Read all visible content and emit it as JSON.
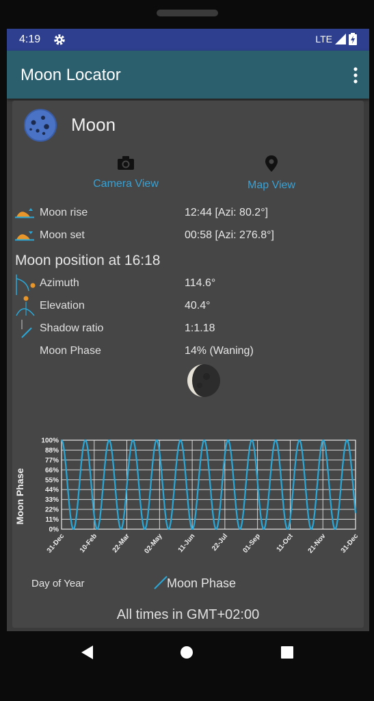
{
  "status_bar": {
    "time": "4:19",
    "network": "LTE"
  },
  "app_bar": {
    "title": "Moon Locator"
  },
  "header": {
    "title": "Moon"
  },
  "views": {
    "camera_label": "Camera View",
    "map_label": "Map View"
  },
  "rise_set": [
    {
      "label": "Moon rise",
      "value": "12:44 [Azi: 80.2°]"
    },
    {
      "label": "Moon set",
      "value": "00:58 [Azi: 276.8°]"
    }
  ],
  "position": {
    "title": "Moon position at 16:18",
    "rows": [
      {
        "label": "Azimuth",
        "value": "114.6°"
      },
      {
        "label": "Elevation",
        "value": "40.4°"
      },
      {
        "label": "Shadow ratio",
        "value": "1:1.18"
      },
      {
        "label": "Moon Phase",
        "value": "14% (Waning)"
      }
    ]
  },
  "colors": {
    "accent": "#37a2d6",
    "app_bar": "#2b5f6d",
    "status_bar": "#2d3f8e",
    "series": "#2aa8d8"
  },
  "chart_data": {
    "type": "line",
    "ylabel": "Moon Phase",
    "xlabel": "Day of Year",
    "y_ticks": [
      "100%",
      "88%",
      "77%",
      "66%",
      "55%",
      "44%",
      "33%",
      "22%",
      "11%",
      "0%"
    ],
    "x_ticks": [
      "31-Dec",
      "10-Feb",
      "22-Mar",
      "02-May",
      "11-Jun",
      "22-Jul",
      "01-Sep",
      "11-Oct",
      "21-Nov",
      "31-Dec"
    ],
    "ylim": [
      0,
      100
    ],
    "xlim": [
      0,
      365
    ],
    "grid": true,
    "legend_position": "bottom",
    "series": [
      {
        "name": "Moon Phase",
        "function": "cosine",
        "period_days": 29.53,
        "peaks_days": [
          0,
          29.5,
          59.1,
          88.6,
          118.1,
          147.7,
          177.2,
          206.7,
          236.2,
          265.8,
          295.3,
          324.8,
          354.4
        ],
        "min": 0,
        "max": 100
      }
    ]
  },
  "footer": {
    "text": "All times in GMT+02:00"
  }
}
